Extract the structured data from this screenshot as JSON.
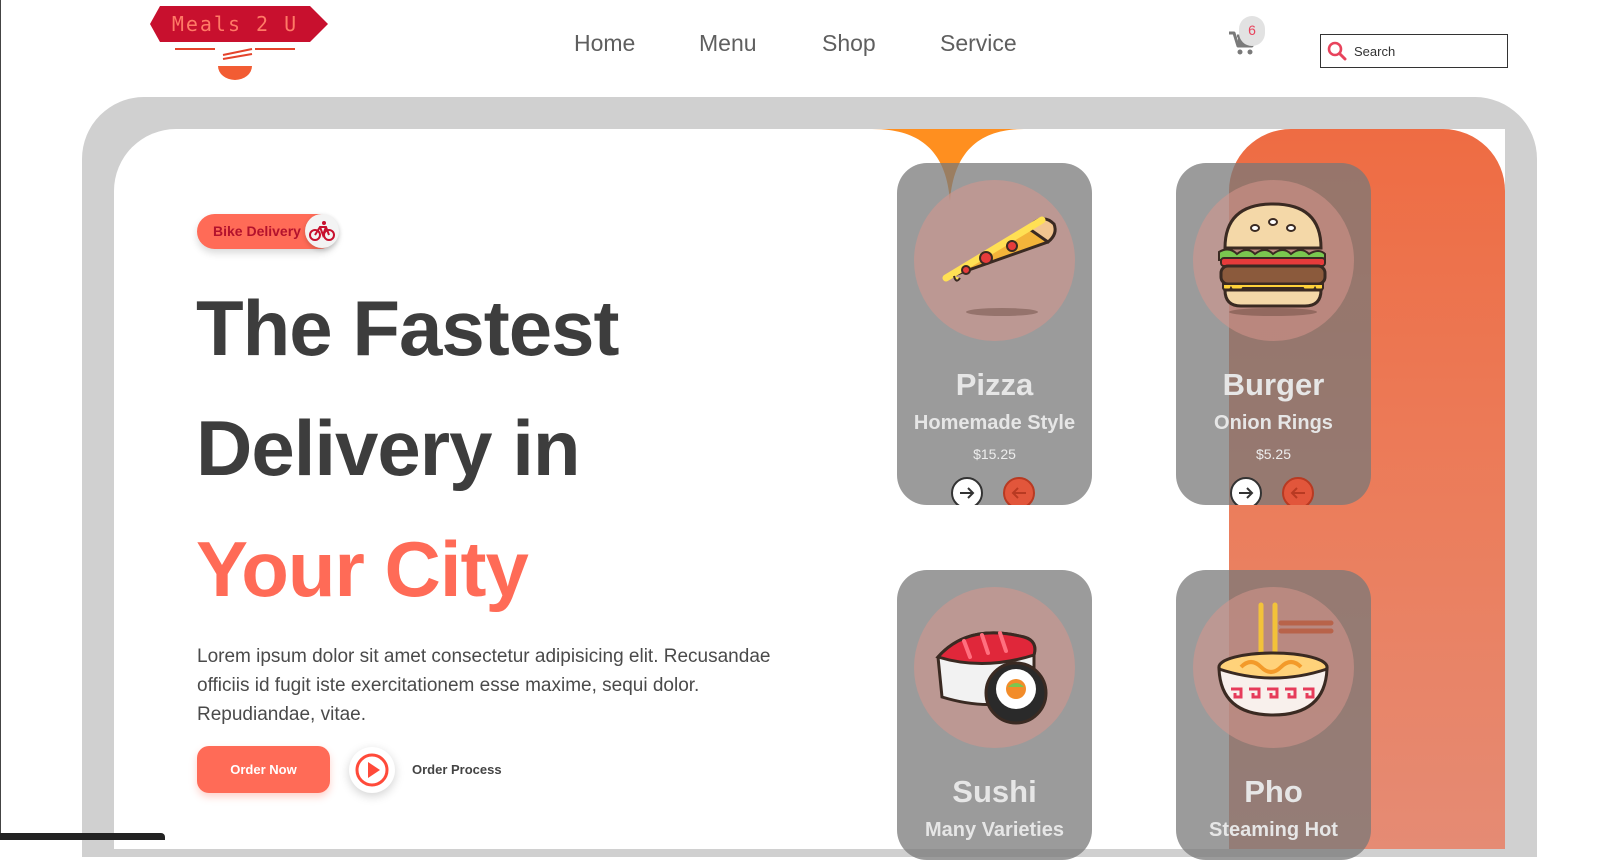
{
  "brand": {
    "logo_text": "Meals 2 U"
  },
  "nav": {
    "items": [
      "Home",
      "Menu",
      "Shop",
      "Service"
    ]
  },
  "cart": {
    "count": "6"
  },
  "search": {
    "placeholder": "Search"
  },
  "hero": {
    "badge": "Bike Delivery",
    "title_line1": "The Fastest",
    "title_line2": "Delivery in",
    "title_line3": "Your City",
    "description": "Lorem ipsum dolor sit amet consectetur adipisicing elit. Recusandae officiis id fugit iste exercitationem esse maxime, sequi dolor. Repudiandae, vitae.",
    "order_button": "Order Now",
    "process_label": "Order Process"
  },
  "foods": [
    {
      "name": "Pizza",
      "sub": "Homemade Style",
      "price": "$15.25"
    },
    {
      "name": "Burger",
      "sub": "Onion Rings",
      "price": "$5.25"
    },
    {
      "name": "Sushi",
      "sub": "Many Varieties",
      "price": ""
    },
    {
      "name": "Pho",
      "sub": "Steaming Hot",
      "price": ""
    }
  ],
  "colors": {
    "accent": "#ff6b57",
    "brand_red": "#c8102e",
    "orange": "#ee6c43"
  }
}
